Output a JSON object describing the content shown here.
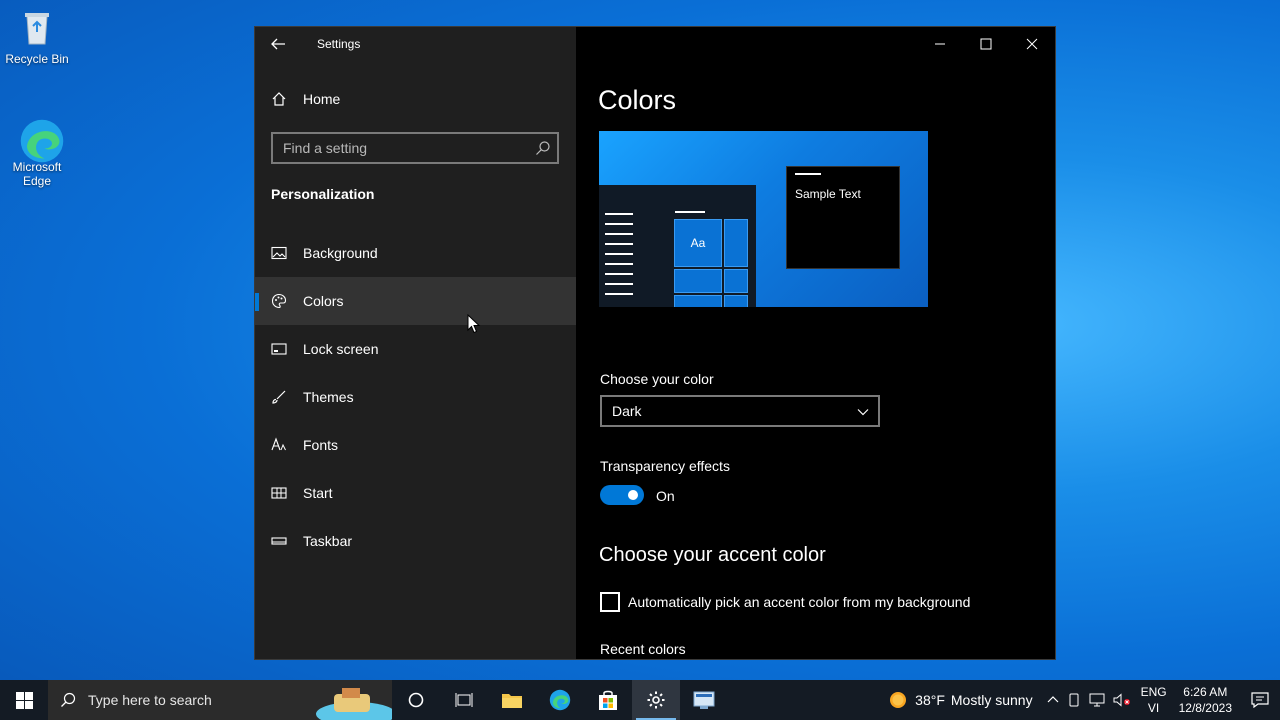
{
  "desktop": {
    "icons": [
      {
        "label": "Recycle Bin",
        "icon": "recycle-bin-icon"
      },
      {
        "label": "Microsoft Edge",
        "icon": "edge-icon"
      }
    ]
  },
  "window": {
    "title": "Settings",
    "sidebar": {
      "home_label": "Home",
      "search_placeholder": "Find a setting",
      "section_label": "Personalization",
      "items": [
        {
          "label": "Background",
          "icon": "picture-icon"
        },
        {
          "label": "Colors",
          "icon": "palette-icon",
          "active": true
        },
        {
          "label": "Lock screen",
          "icon": "lock-screen-icon"
        },
        {
          "label": "Themes",
          "icon": "brush-icon"
        },
        {
          "label": "Fonts",
          "icon": "font-icon"
        },
        {
          "label": "Start",
          "icon": "start-layout-icon"
        },
        {
          "label": "Taskbar",
          "icon": "taskbar-icon"
        }
      ]
    },
    "content": {
      "title": "Colors",
      "preview": {
        "sample_text": "Sample Text",
        "tile_text": "Aa"
      },
      "choose_color_label": "Choose your color",
      "choose_color_value": "Dark",
      "transparency_label": "Transparency effects",
      "transparency_state": "On",
      "accent_title": "Choose your accent color",
      "auto_accent_label": "Automatically pick an accent color from my background",
      "recent_colors_label": "Recent colors"
    },
    "accent_color": "#0078d7"
  },
  "taskbar": {
    "search_placeholder": "Type here to search",
    "weather": {
      "temp": "38°F",
      "condition": "Mostly sunny"
    },
    "language": {
      "line1": "ENG",
      "line2": "VI"
    },
    "clock": {
      "time": "6:26 AM",
      "date": "12/8/2023"
    }
  }
}
